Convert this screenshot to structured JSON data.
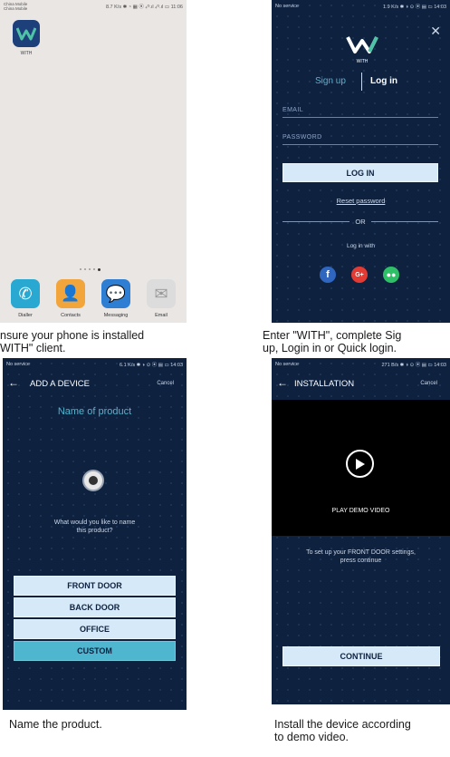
{
  "panel1": {
    "carrier": "China Mobile\nChina Mobile",
    "status": "8.7 K/s ✱ ◔ ▦ ⦿ ₄ᴳ.ıl ₄ᴳ.ıl ▭ 11:06",
    "app_label": "WITH",
    "dock": [
      "Dialler",
      "Contacts",
      "Messaging",
      "Email"
    ],
    "caption": "nsure your phone is installed\nWITH\" client."
  },
  "panel2": {
    "status_left": "No service",
    "status_right": "1.9 K/s ✱ ◑ ⊙ ⦿ ▤ ▭ 14:03",
    "logo_text": "WITH",
    "tab_signup": "Sign up",
    "tab_login": "Log in",
    "email_placeholder": "EMAIL",
    "password_placeholder": "PASSWORD",
    "login_button": "LOG IN",
    "reset_link": "Reset password",
    "or_text": "OR",
    "login_with": "Log in with",
    "caption": "Enter \"WITH\", complete Sig\nup, Login in or Quick login."
  },
  "panel3": {
    "status_left": "No service",
    "status_right": "6.1 K/s ✱ ◑ ⊙ ⦿ ▤ ▭ 14:03",
    "title": "ADD A DEVICE",
    "cancel": "Cancel",
    "heading": "Name of product",
    "question": "What would you like to name\nthis product?",
    "options": [
      "FRONT DOOR",
      "BACK DOOR",
      "OFFICE",
      "CUSTOM"
    ],
    "caption": "Name the product."
  },
  "panel4": {
    "status_left": "No service",
    "status_right": "271 B/s ✱ ◑ ⊙ ⦿ ▤ ▭ 14:03",
    "title": "INSTALLATION",
    "cancel": "Cancel",
    "video_label": "PLAY DEMO VIDEO",
    "instructions": "To set up your FRONT DOOR settings,\npress continue",
    "continue_button": "CONTINUE",
    "caption": "Install the device according\nto demo video."
  },
  "colors": {
    "navy": "#0e2240",
    "button_light": "#d6e9f8",
    "custom_teal": "#4fb6cf",
    "facebook": "#2f66bf",
    "google": "#e23b34",
    "wechat": "#2fbf66"
  }
}
